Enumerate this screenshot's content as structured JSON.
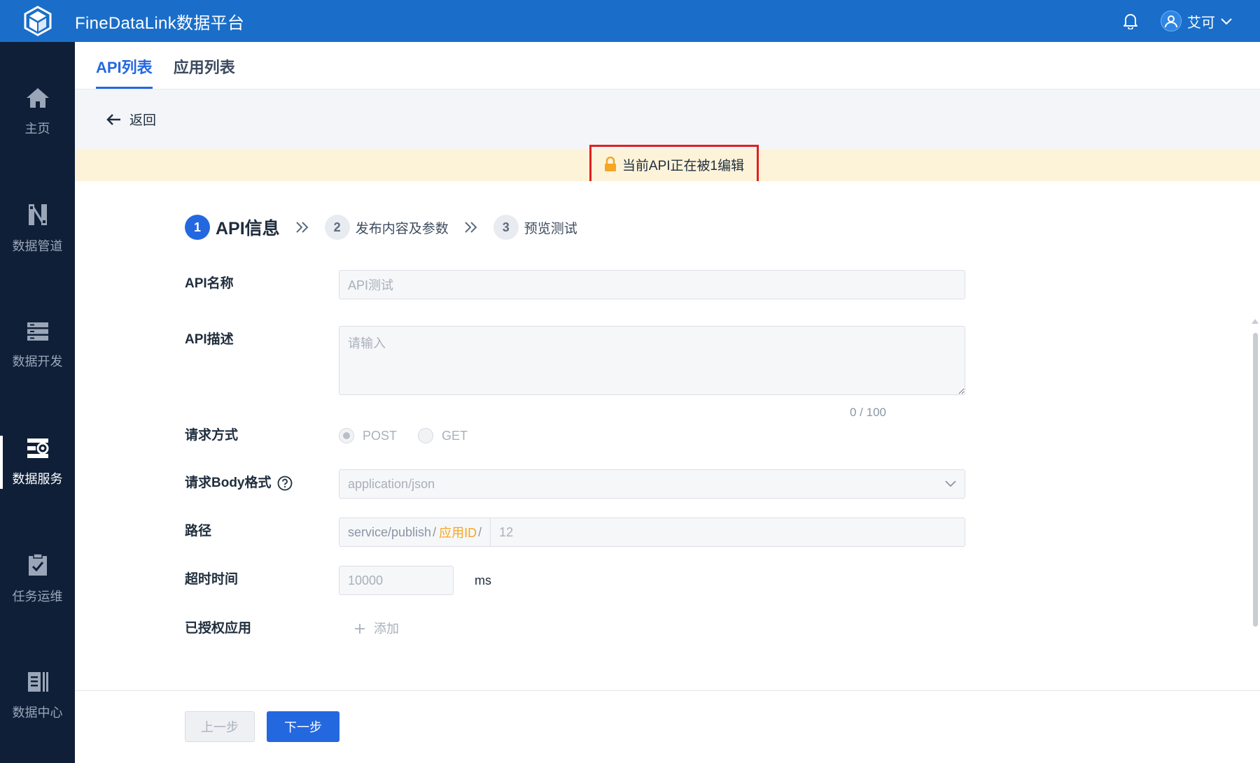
{
  "header": {
    "app_title": "FineDataLink数据平台",
    "user_name": "艾可"
  },
  "sidebar": {
    "items": [
      {
        "label": "主页",
        "icon": "home-icon"
      },
      {
        "label": "数据管道",
        "icon": "pipeline-icon"
      },
      {
        "label": "数据开发",
        "icon": "dev-icon"
      },
      {
        "label": "数据服务",
        "icon": "service-icon",
        "active": true
      },
      {
        "label": "任务运维",
        "icon": "ops-icon"
      },
      {
        "label": "数据中心",
        "icon": "datacenter-icon"
      }
    ]
  },
  "tabs": [
    {
      "label": "API列表",
      "active": true
    },
    {
      "label": "应用列表",
      "active": false
    }
  ],
  "back_label": "返回",
  "warning": {
    "text": "当前API正在被1编辑"
  },
  "steps": [
    {
      "num": "1",
      "label": "API信息"
    },
    {
      "num": "2",
      "label": "发布内容及参数"
    },
    {
      "num": "3",
      "label": "预览测试"
    }
  ],
  "form": {
    "api_name": {
      "label": "API名称",
      "value": "API测试"
    },
    "api_desc": {
      "label": "API描述",
      "placeholder": "请输入",
      "counter": "0 / 100"
    },
    "method": {
      "label": "请求方式",
      "options": [
        "POST",
        "GET"
      ],
      "selected": "POST"
    },
    "body_format": {
      "label": "请求Body格式",
      "value": "application/json"
    },
    "path": {
      "label": "路径",
      "prefix": "service/publish",
      "slash": "/",
      "app_id": "应用ID",
      "value": "12"
    },
    "timeout": {
      "label": "超时时间",
      "value": "10000",
      "unit": "ms"
    },
    "authorized_apps": {
      "label": "已授权应用",
      "add_label": "添加"
    }
  },
  "footer": {
    "prev_label": "上一步",
    "next_label": "下一步"
  },
  "colors": {
    "topbar": "#1a6ec9",
    "sidebar": "#0f1f38",
    "primary": "#2468e0",
    "warning_bg": "#fdf3d9",
    "highlight_border": "#e02020",
    "app_id": "#f5a623"
  }
}
